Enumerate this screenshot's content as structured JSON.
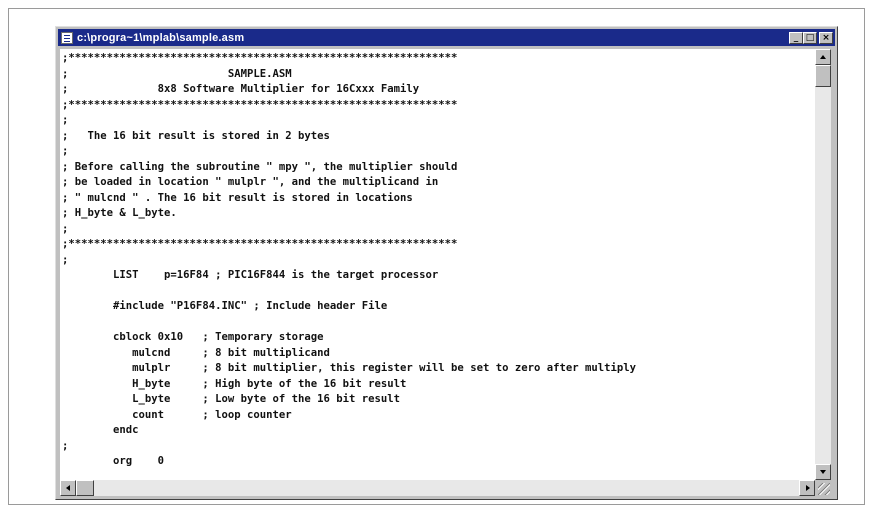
{
  "window": {
    "title": "c:\\progra~1\\mplab\\sample.asm",
    "buttons": {
      "minimize": "_",
      "maximize": "□",
      "close": "×"
    }
  },
  "editor": {
    "lines": [
      ";*************************************************************",
      ";                         SAMPLE.ASM",
      ";              8x8 Software Multiplier for 16Cxxx Family",
      ";*************************************************************",
      ";",
      ";   The 16 bit result is stored in 2 bytes",
      ";",
      "; Before calling the subroutine \" mpy \", the multiplier should",
      "; be loaded in location \" mulplr \", and the multiplicand in",
      "; \" mulcnd \" . The 16 bit result is stored in locations",
      "; H_byte & L_byte.",
      ";",
      ";*************************************************************",
      ";",
      "        LIST    p=16F84 ; PIC16F844 is the target processor",
      "",
      "        #include \"P16F84.INC\" ; Include header File",
      "",
      "        cblock 0x10   ; Temporary storage",
      "           mulcnd     ; 8 bit multiplicand",
      "           mulplr     ; 8 bit multiplier, this register will be set to zero after multiply",
      "           H_byte     ; High byte of the 16 bit result",
      "           L_byte     ; Low byte of the 16 bit result",
      "           count      ; loop counter",
      "        endc",
      ";",
      "        org    0"
    ]
  }
}
